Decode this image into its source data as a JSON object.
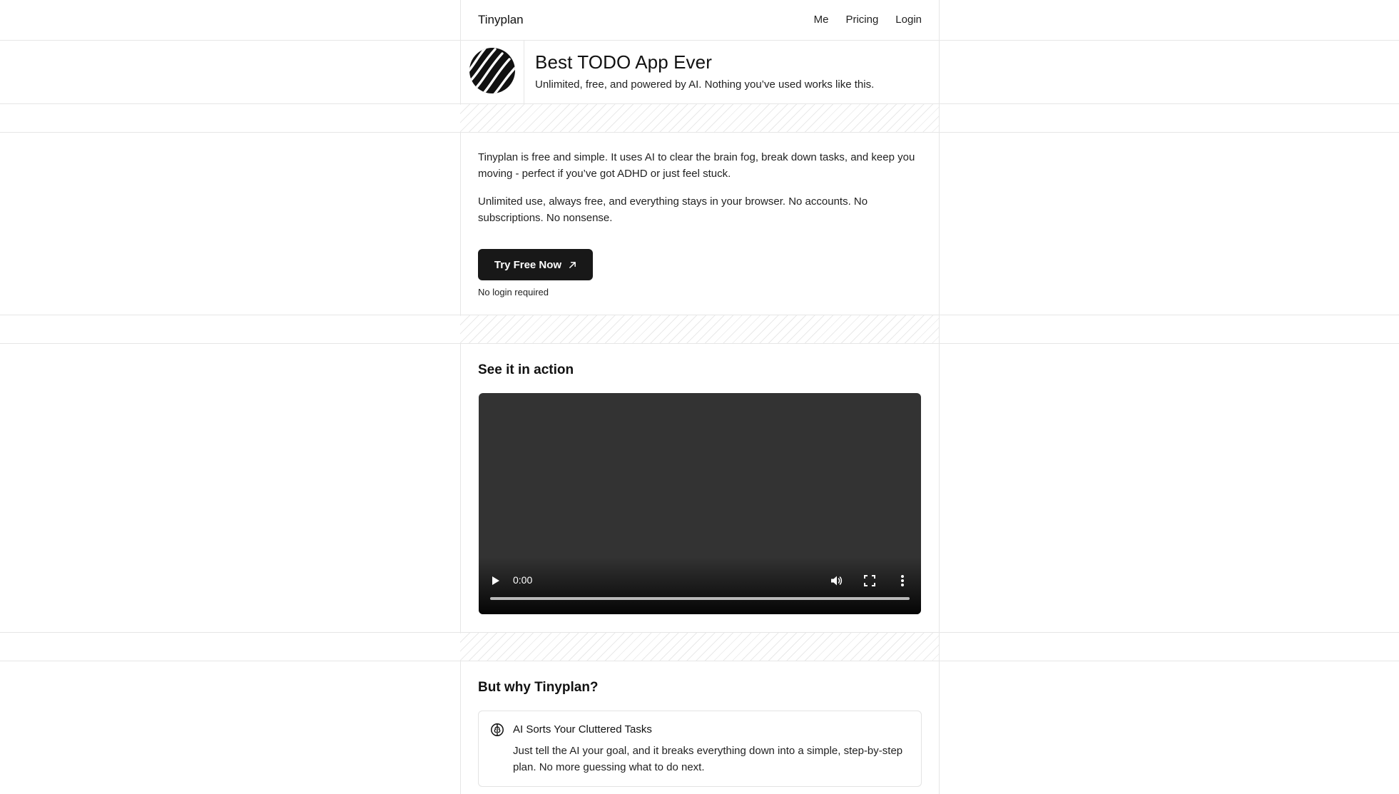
{
  "nav": {
    "brand": "Tinyplan",
    "links": [
      {
        "label": "Me"
      },
      {
        "label": "Pricing"
      },
      {
        "label": "Login"
      }
    ]
  },
  "hero": {
    "title": "Best TODO App Ever",
    "subtitle": "Unlimited, free, and powered by AI. Nothing you’ve used works like this."
  },
  "intro": {
    "paragraphs": [
      "Tinyplan is free and simple. It uses AI to clear the brain fog, break down tasks, and keep you moving - perfect if you’ve got ADHD or just feel stuck.",
      "Unlimited use, always free, and everything stays in your browser. No accounts. No subscriptions. No nonsense."
    ],
    "cta_label": "Try Free Now",
    "note": "No login required"
  },
  "demo": {
    "title": "See it in action",
    "video": {
      "time": "0:00",
      "progress": 0
    }
  },
  "why": {
    "title": "But why Tinyplan?",
    "features": [
      {
        "icon": "brain-icon",
        "title": "AI Sorts Your Cluttered Tasks",
        "text": "Just tell the AI your goal, and it breaks everything down into a simple, step-by-step plan. No more guessing what to do next."
      }
    ]
  },
  "colors": {
    "button_bg": "#181818",
    "video_bg": "#333333",
    "border": "#e6e6e6"
  }
}
